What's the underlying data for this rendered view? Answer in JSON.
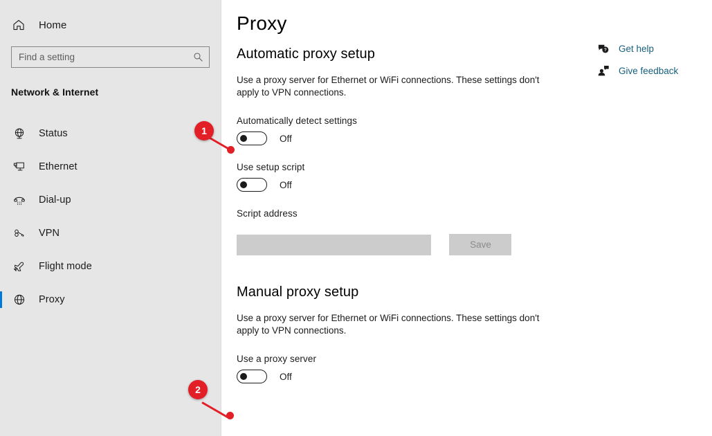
{
  "sidebar": {
    "home": {
      "label": "Home",
      "icon": "home-icon"
    },
    "search": {
      "placeholder": "Find a setting",
      "value": "",
      "icon": "search-icon"
    },
    "group_title": "Network & Internet",
    "items": [
      {
        "label": "Status",
        "icon": "status-globe-icon",
        "selected": false
      },
      {
        "label": "Ethernet",
        "icon": "ethernet-icon",
        "selected": false
      },
      {
        "label": "Dial-up",
        "icon": "dialup-phone-icon",
        "selected": false
      },
      {
        "label": "VPN",
        "icon": "vpn-key-icon",
        "selected": false
      },
      {
        "label": "Flight mode",
        "icon": "airplane-icon",
        "selected": false
      },
      {
        "label": "Proxy",
        "icon": "proxy-globe-icon",
        "selected": true
      }
    ]
  },
  "main": {
    "page_title": "Proxy",
    "automatic": {
      "heading": "Automatic proxy setup",
      "description": "Use a proxy server for Ethernet or WiFi connections. These settings don't apply to VPN connections.",
      "detect_label": "Automatically detect settings",
      "detect_state": "Off",
      "script_toggle_label": "Use setup script",
      "script_toggle_state": "Off",
      "script_address_label": "Script address",
      "script_address_value": "",
      "save_label": "Save"
    },
    "manual": {
      "heading": "Manual proxy setup",
      "description": "Use a proxy server for Ethernet or WiFi connections. These settings don't apply to VPN connections.",
      "proxy_toggle_label": "Use a proxy server",
      "proxy_toggle_state": "Off"
    }
  },
  "right_links": [
    {
      "label": "Get help",
      "icon": "help-bubble-icon"
    },
    {
      "label": "Give feedback",
      "icon": "feedback-person-icon"
    }
  ],
  "annotations": [
    {
      "number": "1",
      "color": "#e21f26"
    },
    {
      "number": "2",
      "color": "#e21f26"
    }
  ]
}
